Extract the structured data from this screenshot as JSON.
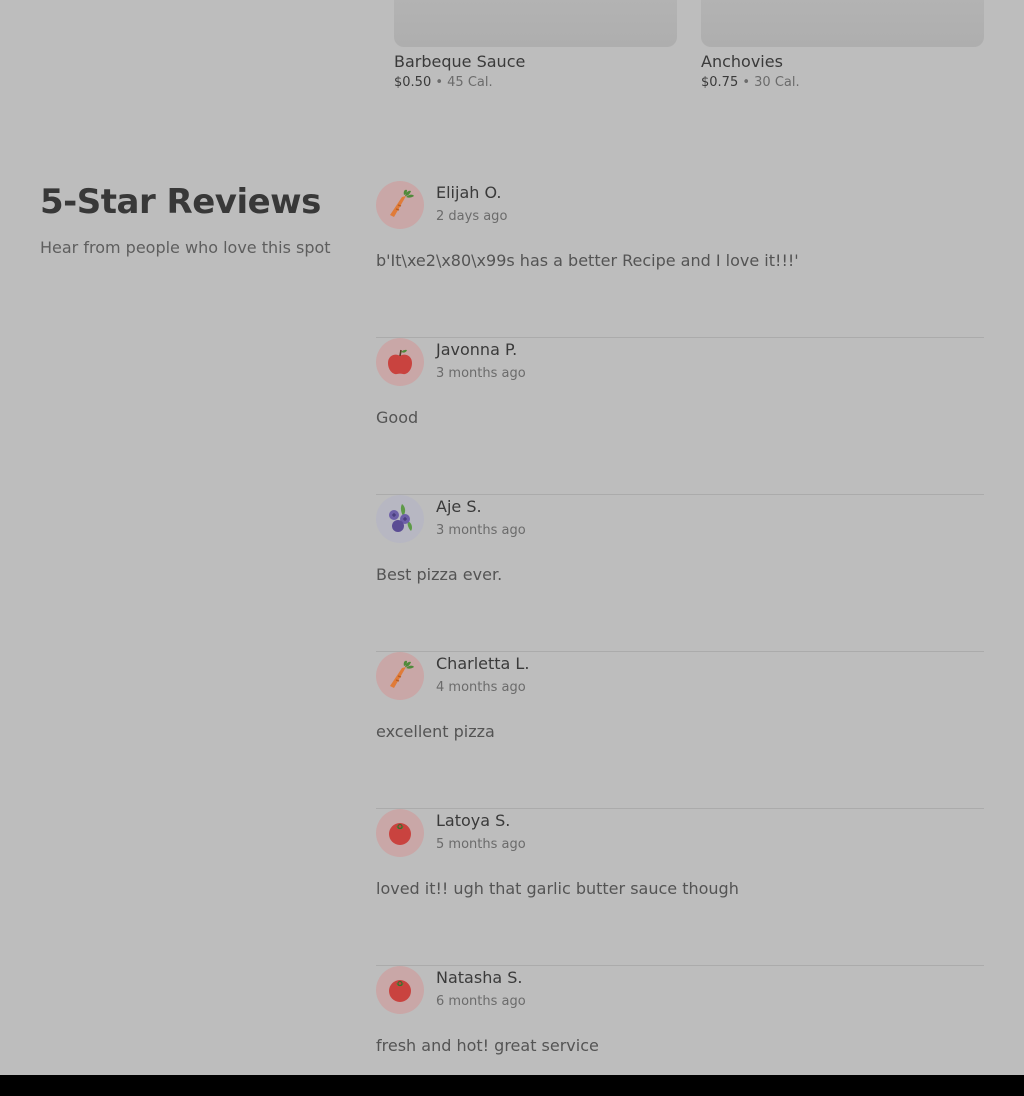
{
  "addons": [
    {
      "name": "Barbeque Sauce",
      "price": "$0.50",
      "sep": " • ",
      "calories": "45 Cal."
    },
    {
      "name": "Anchovies",
      "price": "$0.75",
      "sep": " • ",
      "calories": "30 Cal."
    }
  ],
  "reviews_section": {
    "title": "5-Star Reviews",
    "subtitle": "Hear from people who love this spot"
  },
  "reviews": [
    {
      "name": "Elijah O.",
      "date": "2 days ago",
      "text": "b'It\\xe2\\x80\\x99s has a better Recipe and I love it!!!'",
      "avatar_icon": "carrot-icon"
    },
    {
      "name": "Javonna P.",
      "date": "3 months ago",
      "text": "Good",
      "avatar_icon": "apple-icon"
    },
    {
      "name": "Aje S.",
      "date": "3 months ago",
      "text": "Best pizza ever.",
      "avatar_icon": "blueberries-icon"
    },
    {
      "name": "Charletta L.",
      "date": "4 months ago",
      "text": "excellent pizza",
      "avatar_icon": "carrot-icon"
    },
    {
      "name": "Latoya S.",
      "date": "5 months ago",
      "text": "loved it!! ugh that garlic butter sauce though",
      "avatar_icon": "tomato-icon"
    },
    {
      "name": "Natasha S.",
      "date": "6 months ago",
      "text": "fresh and hot! great service",
      "avatar_icon": "tomato-icon"
    }
  ],
  "colors": {
    "overlay_background": "#bdbdbd",
    "avatar_background": "#c9a7a7",
    "divider": "#ababab"
  }
}
